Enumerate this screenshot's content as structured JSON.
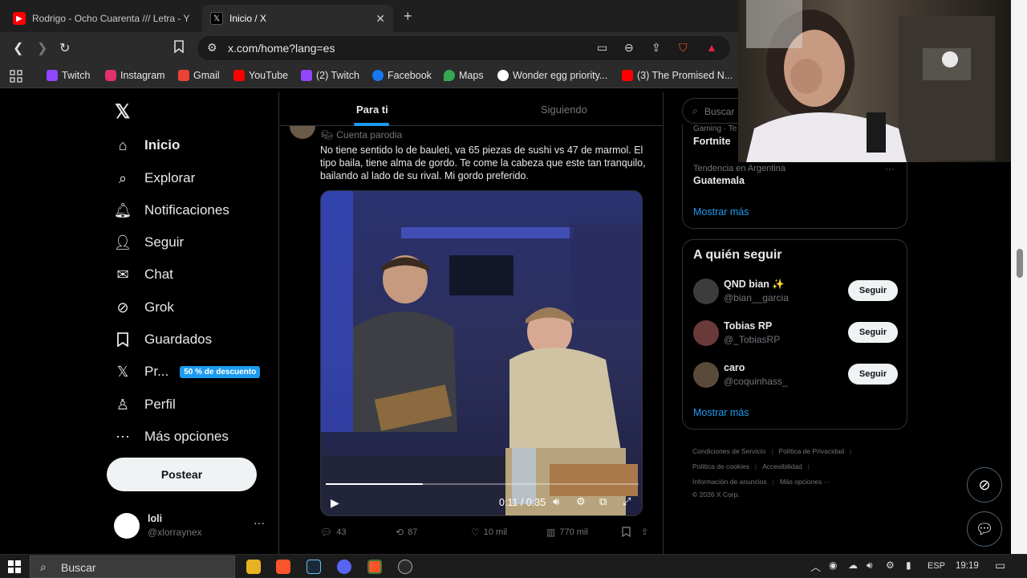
{
  "browser": {
    "tabs": [
      {
        "title": "Rodrigo - Ocho Cuarenta /// Letra - Y",
        "icon": "youtube-icon"
      },
      {
        "title": "Inicio / X",
        "icon": "x-icon"
      }
    ],
    "url": "x.com/home?lang=es",
    "bookmarks": [
      {
        "label": "Twitch",
        "icon": "twitch-icon",
        "color": "#9146ff"
      },
      {
        "label": "Instagram",
        "icon": "instagram-icon",
        "color": "#e1306c"
      },
      {
        "label": "Gmail",
        "icon": "gmail-icon",
        "color": "#ea4335"
      },
      {
        "label": "YouTube",
        "icon": "youtube-icon",
        "color": "#ff0000"
      },
      {
        "label": "(2) Twitch",
        "icon": "twitch-icon",
        "color": "#9146ff"
      },
      {
        "label": "Facebook",
        "icon": "facebook-icon",
        "color": "#1877f2"
      },
      {
        "label": "Maps",
        "icon": "maps-icon",
        "color": "#34a853"
      },
      {
        "label": "Wonder egg priority...",
        "icon": "google-icon",
        "color": "#ffffff"
      },
      {
        "label": "(3) The Promised N...",
        "icon": "youtube-icon",
        "color": "#ff0000"
      }
    ]
  },
  "nav": {
    "items": [
      {
        "label": "Inicio",
        "icon": "home-icon"
      },
      {
        "label": "Explorar",
        "icon": "search-icon"
      },
      {
        "label": "Notificaciones",
        "icon": "bell-icon"
      },
      {
        "label": "Seguir",
        "icon": "follow-icon"
      },
      {
        "label": "Chat",
        "icon": "mail-icon"
      },
      {
        "label": "Grok",
        "icon": "grok-icon"
      },
      {
        "label": "Guardados",
        "icon": "bookmark-icon"
      },
      {
        "label": "Pr...",
        "icon": "x-icon"
      },
      {
        "label": "Perfil",
        "icon": "person-icon"
      },
      {
        "label": "Más opciones",
        "icon": "more-circle-icon"
      }
    ],
    "promo_badge": "50 % de descuento",
    "post_label": "Postear",
    "user": {
      "name": "loli",
      "handle": "@xlorraynex"
    }
  },
  "feed": {
    "tabs": [
      "Para ti",
      "Siguiendo"
    ],
    "tweet": {
      "label": "Cuenta parodia",
      "text": "No tiene sentido lo de bauleti, va 65 piezas de sushi vs 47 de marmol. El tipo baila, tiene alma de gordo. Te come la cabeza que este tan tranquilo, bailando al lado de su rival. Mi gordo preferido.",
      "video_time": "0:11 / 0:35",
      "video_progress": 0.31,
      "replies": "43",
      "reposts": "87",
      "likes": "10 mil",
      "views": "770 mil"
    }
  },
  "sidebar": {
    "search_placeholder": "Buscar",
    "trends": [
      {
        "context": "Gaming · Te",
        "name": "Fortnite"
      },
      {
        "context": "Tendencia en Argentina",
        "name": "Guatemala"
      }
    ],
    "trends_more": "Mostrar más",
    "follow_title": "A quién seguir",
    "follow": [
      {
        "name": "QND bian ✨",
        "handle": "@bian__garcia",
        "button": "Seguir"
      },
      {
        "name": "Tobias RP",
        "handle": "@_TobiasRP",
        "button": "Seguir"
      },
      {
        "name": "caro",
        "handle": "@coquinhass_",
        "button": "Seguir"
      }
    ],
    "follow_more": "Mostrar más",
    "footer": [
      "Condiciones de Servicio",
      "Política de Privacidad",
      "Política de cookies",
      "Accesibilidad",
      "Información de anuncios",
      "Más opciones ···",
      "© 2026 X Corp."
    ]
  },
  "taskbar": {
    "search": "Buscar",
    "lang": "ESP",
    "time": "19:19"
  }
}
